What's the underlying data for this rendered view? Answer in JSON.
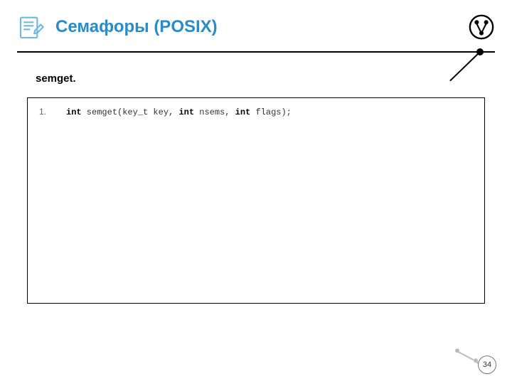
{
  "header": {
    "title": "Семафоры (POSIX)"
  },
  "section": {
    "subtitle": "semget."
  },
  "code": {
    "lines": [
      {
        "no": "1.",
        "tokens": [
          "int",
          " semget(key_t key, ",
          "int",
          " nsems, ",
          "int",
          " flags);"
        ]
      }
    ]
  },
  "page": {
    "number": "34"
  }
}
